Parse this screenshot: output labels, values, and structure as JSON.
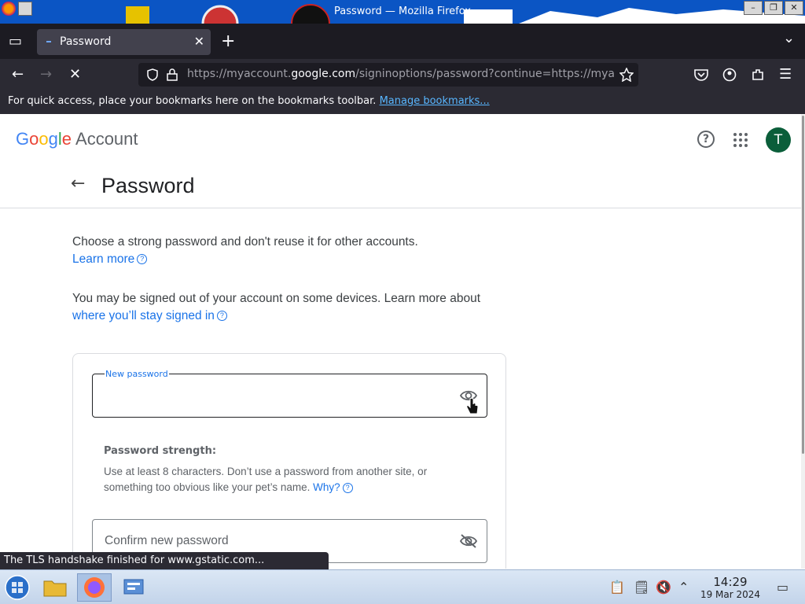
{
  "window": {
    "title": "Password — Mozilla Firefox",
    "controls": [
      "minimize",
      "maximize",
      "close"
    ]
  },
  "tabs": [
    {
      "label": "Password",
      "favicon": "google-favicon",
      "active": true
    }
  ],
  "tabbar": {
    "new_tab_symbol": "+",
    "list_all_tabs_symbol": "⌄"
  },
  "navbar": {
    "url_prefix": "https://myaccount.",
    "url_domain": "google.com",
    "url_suffix": "/signinoptions/password?continue=https://mya"
  },
  "bookmarks_bar": {
    "message": "For quick access, place your bookmarks here on the bookmarks toolbar.",
    "link": "Manage bookmarks..."
  },
  "page": {
    "logo_word": "Google",
    "logo_account": "Account",
    "avatar_letter": "T",
    "avatar_color": "#0b5e3a",
    "title": "Password",
    "intro": "Choose a strong password and don't reuse it for other accounts.",
    "intro_link": "Learn more",
    "signout_text": "You may be signed out of your account on some devices. Learn more about",
    "signout_link": "where you’ll stay signed in",
    "new_password_label": "New password",
    "strength_title": "Password strength:",
    "strength_desc": "Use at least 8 characters. Don’t use a password from another site, or something too obvious like your pet’s name.",
    "strength_link": "Why?",
    "confirm_placeholder": "Confirm new password"
  },
  "status": {
    "message": "The TLS handshake finished for www.gstatic.com..."
  },
  "taskbar": {
    "time": "14:29",
    "date": "19 Mar 2024"
  },
  "colors": {
    "accent_link": "#1a73e8",
    "google_blue": "#4285f4",
    "google_red": "#ea4335",
    "google_yellow": "#fbbc05",
    "google_green": "#34a853"
  }
}
